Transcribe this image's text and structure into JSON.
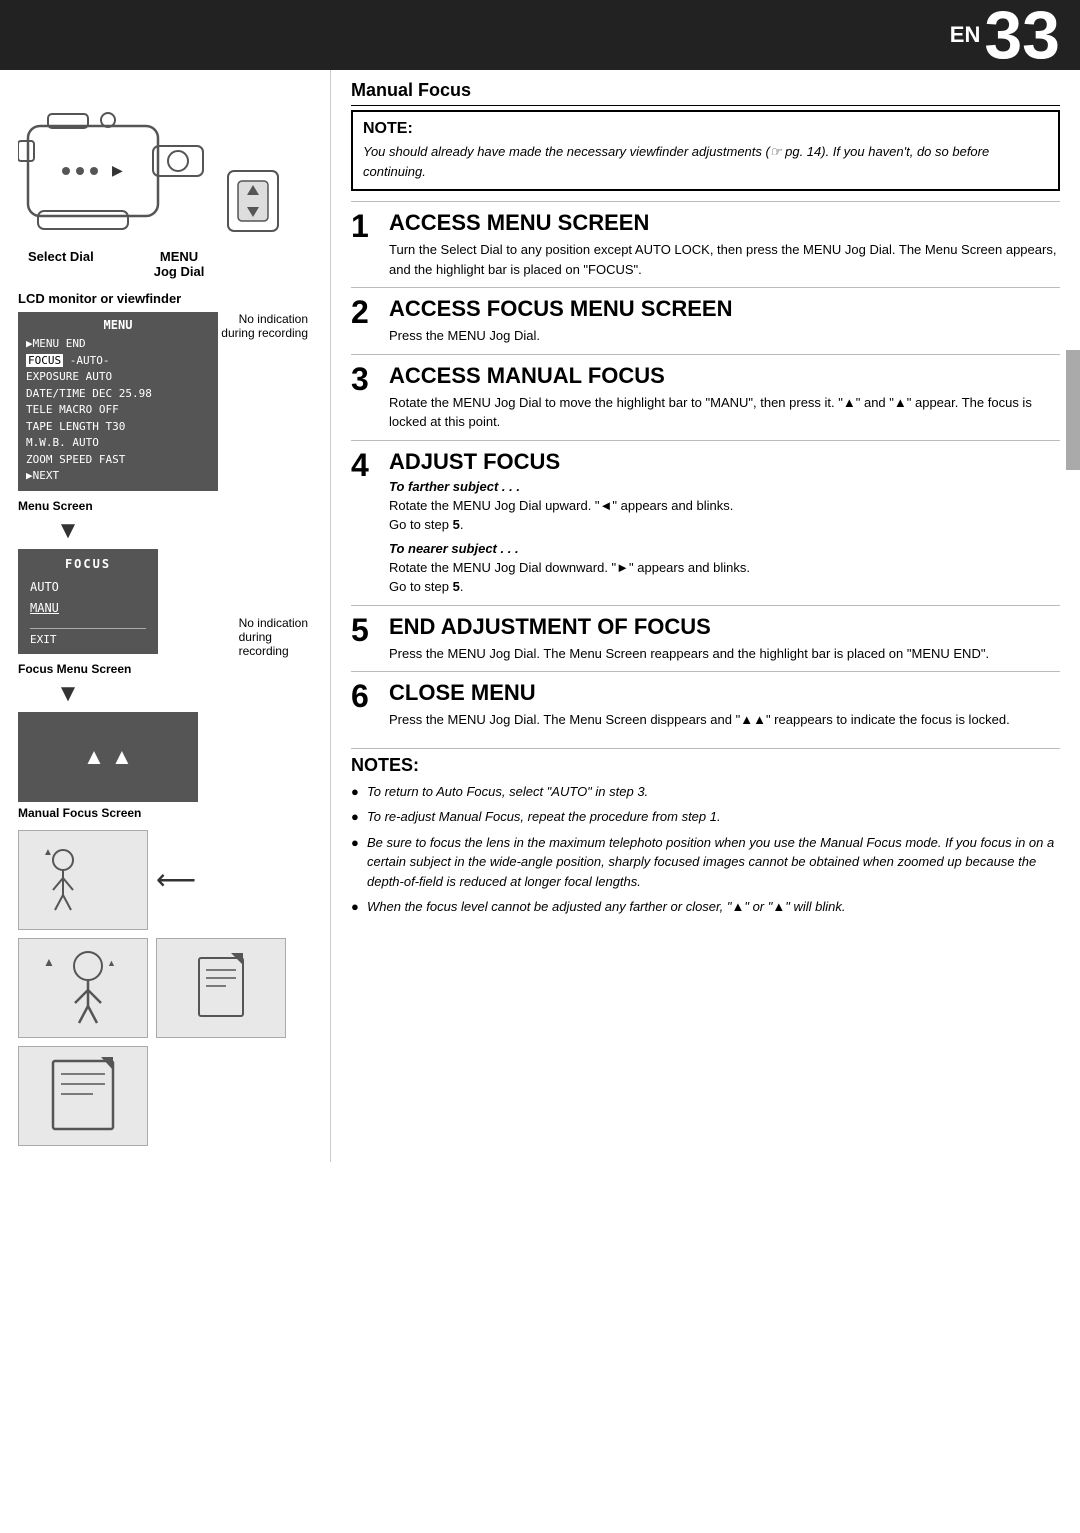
{
  "header": {
    "en_label": "EN",
    "page_number": "33"
  },
  "left": {
    "select_dial_label": "Select Dial",
    "menu_jog_dial_label": "MENU\nJog Dial",
    "lcd_monitor_label": "LCD monitor or viewfinder",
    "menu_screen_label": "Menu Screen",
    "no_indication_label": "No indication\nduring recording",
    "focus_menu_screen_label": "Focus Menu Screen",
    "no_indication_label2": "No indication\nduring\nrecording",
    "manual_focus_screen_label": "Manual Focus Screen",
    "menu_items": [
      "▶MENU END",
      "FOCUS    -AUTO-",
      "EXPOSURE   AUTO",
      "DATE/TIME  DEC 25.98",
      "TELE MACRO OFF",
      "TAPE LENGTH T30",
      "M.W.B.     AUTO",
      "ZOOM SPEED FAST",
      "▶NEXT"
    ]
  },
  "right": {
    "manual_focus_title": "Manual Focus",
    "note_title": "NOTE:",
    "note_body": "You should already have made the necessary viewfinder adjustments (☞ pg. 14). If you haven't, do so before continuing.",
    "steps": [
      {
        "num": "1",
        "heading": "ACCESS MENU SCREEN",
        "body": "Turn the Select Dial to any position except AUTO LOCK, then press the MENU Jog Dial. The Menu Screen appears, and the highlight bar is placed on \"FOCUS\"."
      },
      {
        "num": "2",
        "heading": "ACCESS FOCUS MENU SCREEN",
        "body": "Press the MENU Jog Dial."
      },
      {
        "num": "3",
        "heading": "ACCESS MANUAL FOCUS",
        "body": "Rotate the MENU Jog Dial to move the highlight bar to \"MANU\", then press it. \"▲\" and \"▲\" appear. The focus is locked at this point."
      },
      {
        "num": "4",
        "heading": "ADJUST FOCUS",
        "sub1_italic": "To farther subject . . .",
        "sub1_body": "Rotate the MENU Jog Dial upward. \"◄\" appears and blinks.\nGo to step 5.",
        "sub2_italic": "To nearer subject . . .",
        "sub2_body": "Rotate the MENU Jog Dial downward. \"►\" appears and blinks.\nGo to step 5."
      },
      {
        "num": "5",
        "heading": "END ADJUSTMENT OF FOCUS",
        "body": "Press the MENU Jog Dial. The Menu Screen reappears and the highlight bar is placed on \"MENU END\"."
      },
      {
        "num": "6",
        "heading": "CLOSE MENU",
        "body": "Press the MENU Jog Dial. The Menu Screen disppears and \"▲▲\" reappears to indicate the focus is locked."
      }
    ],
    "notes_title": "NOTES:",
    "notes": [
      "To return to Auto Focus, select \"AUTO\" in step 3.",
      "To re-adjust Manual Focus, repeat the procedure from step 1.",
      "Be sure to focus the lens in the maximum telephoto position when you use the Manual Focus mode. If you focus in on a certain subject in the wide-angle position, sharply focused images cannot be obtained when zoomed up because the depth-of-field is reduced at longer focal lengths.",
      "When the focus level cannot be adjusted any farther or closer, \"▲\" or \"▲\" will blink."
    ]
  }
}
